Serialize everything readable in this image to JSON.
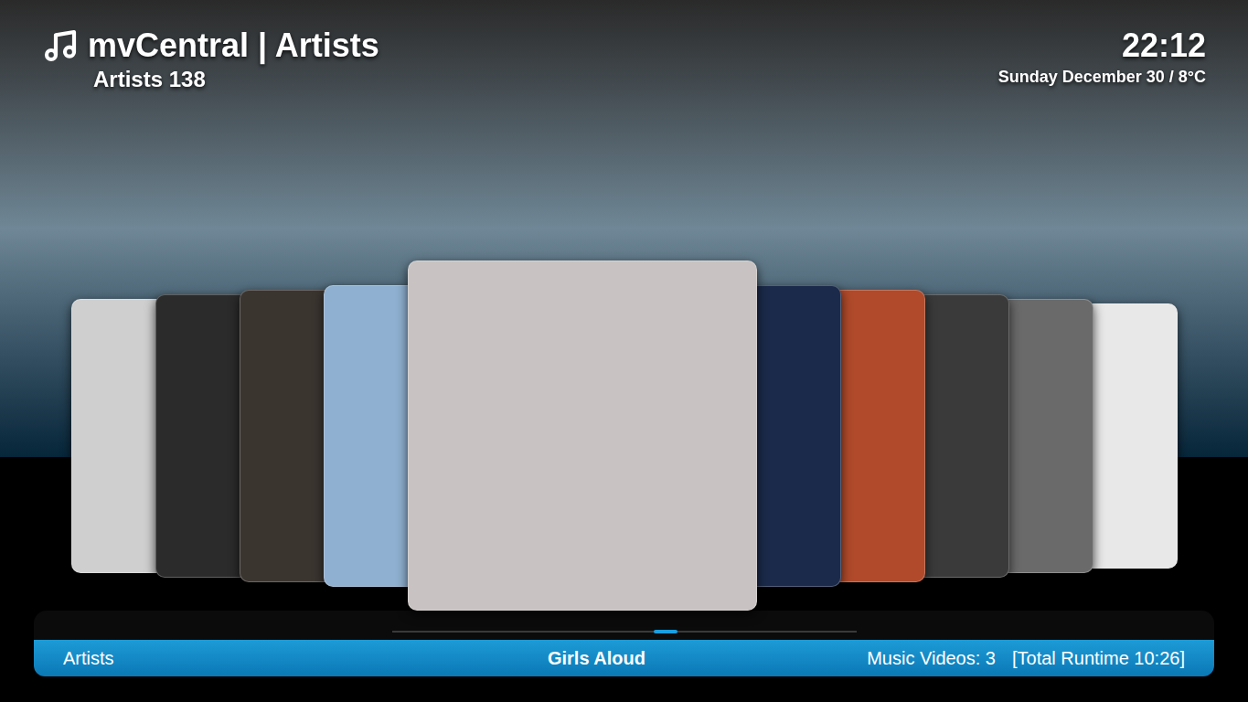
{
  "header": {
    "title": "mvCentral | Artists",
    "subtitle": "Artists 138",
    "time": "22:12",
    "date": "Sunday December 30 / 8°C"
  },
  "covers": [
    {
      "selected": false,
      "color": "#cfcfcf"
    },
    {
      "selected": false,
      "color": "#2b2b2b"
    },
    {
      "selected": false,
      "color": "#3b3530"
    },
    {
      "selected": false,
      "color": "#8fb0d0"
    },
    {
      "selected": true,
      "color": "#c8c3c2"
    },
    {
      "selected": false,
      "color": "#1b2a4a"
    },
    {
      "selected": false,
      "color": "#b04a2a"
    },
    {
      "selected": false,
      "color": "#3a3a3a"
    },
    {
      "selected": false,
      "color": "#6a6a6a"
    },
    {
      "selected": false,
      "color": "#e8e8e8"
    }
  ],
  "scroll": {
    "level": 0.59
  },
  "status_bar": {
    "view": "Artists",
    "artist": "Girls Aloud",
    "videos": "Music Videos: 3",
    "runtime": "[Total Runtime 10:26]"
  }
}
